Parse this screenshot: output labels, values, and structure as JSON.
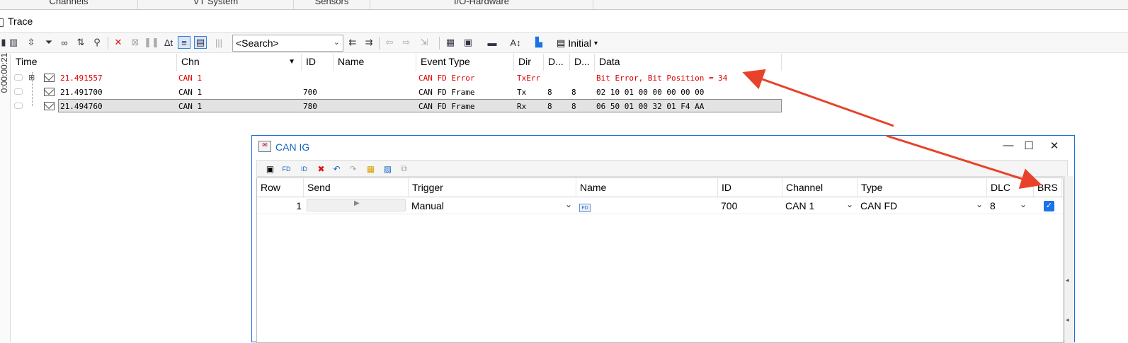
{
  "top_tabs": [
    "Channels",
    "VT System",
    "Sensors",
    "I/O-Hardware"
  ],
  "trace": {
    "title": "Trace",
    "rail_time": "0:00:00:21",
    "toolbar": {
      "search_placeholder": "<Search>",
      "initial_label": "Initial"
    },
    "columns": [
      "Time",
      "Chn",
      "ID",
      "Name",
      "Event Type",
      "Dir",
      "D...",
      "D...",
      "Data"
    ],
    "rows": [
      {
        "time": "21.491557",
        "chn": "CAN 1",
        "id": "",
        "name": "",
        "event": "CAN FD Error",
        "dir": "TxErr",
        "d1": "",
        "d2": "",
        "data": "Bit Error, Bit Position = 34",
        "error": true,
        "selected": false
      },
      {
        "time": "21.491700",
        "chn": "CAN 1",
        "id": "700",
        "name": "",
        "event": "CAN FD Frame",
        "dir": "Tx",
        "d1": "8",
        "d2": "8",
        "data": "02 10 01 00 00 00 00 00",
        "error": false,
        "selected": false
      },
      {
        "time": "21.494760",
        "chn": "CAN 1",
        "id": "780",
        "name": "",
        "event": "CAN FD Frame",
        "dir": "Rx",
        "d1": "8",
        "d2": "8",
        "data": "06 50 01 00 32 01 F4 AA",
        "error": false,
        "selected": true
      }
    ]
  },
  "can_ig": {
    "title": "CAN IG",
    "window_controls": {
      "minimize": "—",
      "maximize": "☐",
      "close": "✕"
    },
    "columns": [
      "Row",
      "Send",
      "Trigger",
      "Name",
      "ID",
      "Channel",
      "Type",
      "DLC",
      "BRS"
    ],
    "rows": [
      {
        "row": "1",
        "trigger": "Manual",
        "name": "",
        "id": "700",
        "channel": "CAN 1",
        "type": "CAN FD",
        "dlc": "8",
        "brs_checked": true
      }
    ]
  },
  "colors": {
    "error_text": "#e00000",
    "annotation_arrow": "#e8432a",
    "dialog_border": "#1e6fd9",
    "checkbox": "#1a73e8"
  },
  "icons": [
    "trace-icon",
    "filter-icon",
    "binoculars-icon",
    "delete-icon",
    "pause-icon",
    "delta-time-icon",
    "search-icon",
    "arrow-left-icon",
    "arrow-right-icon",
    "text-size-icon",
    "can-ig-icon",
    "undo-icon",
    "redo-icon",
    "checkbox-icon"
  ]
}
